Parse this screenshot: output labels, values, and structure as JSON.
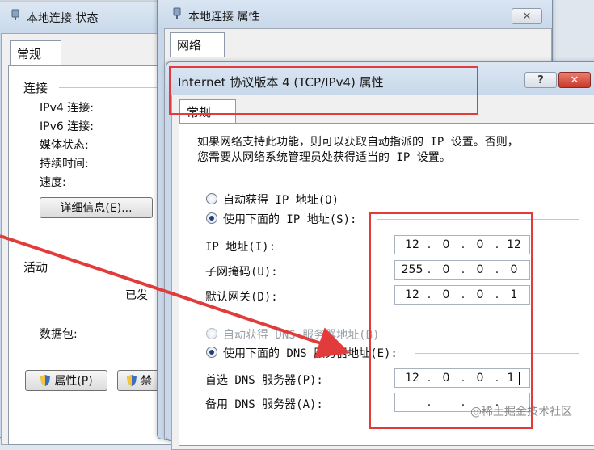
{
  "status_window": {
    "title": "本地连接 状态",
    "tab": "常规",
    "connection_heading": "连接",
    "rows": [
      "IPv4 连接:",
      "IPv6 连接:",
      "媒体状态:",
      "持续时间:",
      "速度:"
    ],
    "details_button": "详细信息(E)...",
    "activity_heading": "活动",
    "sent_partial": "已发",
    "packets_label": "数据包:",
    "properties_button": "属性(P)",
    "disable_partial": "禁"
  },
  "props_window": {
    "title": "本地连接 属性",
    "tab": "网络",
    "close_glyph": "✕"
  },
  "ipv4_dialog": {
    "title": "Internet 协议版本 4 (TCP/IPv4) 属性",
    "help_glyph": "?",
    "close_glyph": "✕",
    "tab": "常规",
    "description_line1": "如果网络支持此功能，则可以获取自动指派的 IP 设置。否则，",
    "description_line2": "您需要从网络系统管理员处获得适当的 IP 设置。",
    "radio_auto_ip": "自动获得 IP 地址(O)",
    "radio_manual_ip": "使用下面的 IP 地址(S):",
    "ip_label": "IP 地址(I):",
    "ip_value": [
      "12",
      "0",
      "0",
      "12"
    ],
    "mask_label": "子网掩码(U):",
    "mask_value": [
      "255",
      "0",
      "0",
      "0"
    ],
    "gateway_label": "默认网关(D):",
    "gateway_value": [
      "12",
      "0",
      "0",
      "1"
    ],
    "radio_auto_dns": "自动获得 DNS 服务器地址(B)",
    "radio_manual_dns": "使用下面的 DNS 服务器地址(E):",
    "preferred_dns_label": "首选 DNS 服务器(P):",
    "preferred_dns_value": [
      "12",
      "0",
      "0",
      "1"
    ],
    "alternate_dns_label": "备用 DNS 服务器(A):",
    "alternate_dns_value": [
      "",
      "",
      "",
      ""
    ],
    "selected_ip_mode": "manual",
    "selected_dns_mode": "manual"
  },
  "watermark": "@稀土掘金技术社区",
  "colors": {
    "annotation_red": "#e23b3b",
    "close_red": "#c9382c"
  },
  "icons": [
    "network-adapter-icon",
    "uac-shield-icon",
    "help-icon",
    "close-icon",
    "arrow-annotation"
  ]
}
